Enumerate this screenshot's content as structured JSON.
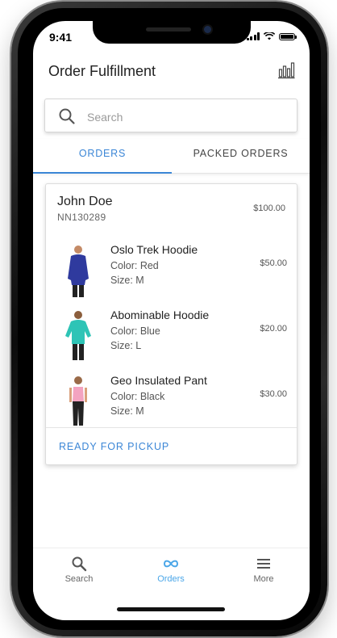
{
  "status_bar": {
    "time": "9:41"
  },
  "header": {
    "title": "Order Fulfillment",
    "chart_icon": "bar-chart-icon"
  },
  "search": {
    "placeholder": "Search",
    "value": ""
  },
  "tabs": [
    {
      "label": "ORDERS",
      "active": true
    },
    {
      "label": "PACKED ORDERS",
      "active": false
    }
  ],
  "order": {
    "customer": "John Doe",
    "order_id": "NN130289",
    "total": "$100.00",
    "items": [
      {
        "name": "Oslo Trek Hoodie",
        "color": "Color: Red",
        "size": "Size: M",
        "price": "$50.00"
      },
      {
        "name": "Abominable Hoodie",
        "color": "Color: Blue",
        "size": "Size: L",
        "price": "$20.00"
      },
      {
        "name": "Geo Insulated Pant",
        "color": "Color: Black",
        "size": "Size: M",
        "price": "$30.00"
      }
    ],
    "action_label": "READY FOR PICKUP"
  },
  "bottom_nav": [
    {
      "label": "Search",
      "icon": "search-icon",
      "active": false
    },
    {
      "label": "Orders",
      "icon": "infinity-icon",
      "active": true
    },
    {
      "label": "More",
      "icon": "menu-icon",
      "active": false
    }
  ],
  "colors": {
    "accent": "#3b86d6",
    "nav_active": "#4aa6e8",
    "text": "#222222"
  }
}
